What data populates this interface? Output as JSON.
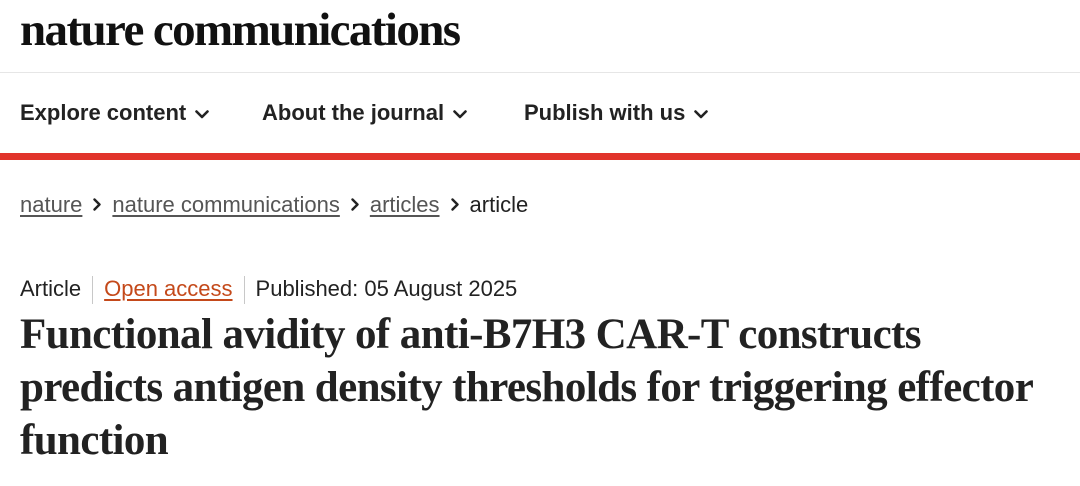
{
  "masthead": {
    "logo_text": "nature communications"
  },
  "nav": {
    "items": [
      {
        "label": "Explore content"
      },
      {
        "label": "About the journal"
      },
      {
        "label": "Publish with us"
      }
    ]
  },
  "breadcrumb": {
    "links": [
      "nature",
      "nature communications",
      "articles"
    ],
    "current": "article"
  },
  "article_meta": {
    "type": "Article",
    "access": "Open access",
    "published": "Published: 05 August 2025"
  },
  "article": {
    "title": "Functional avidity of anti-B7H3 CAR-T constructs predicts antigen density thresholds for triggering effector function"
  },
  "colors": {
    "accent_red": "#e1342b",
    "open_access": "#c4491a",
    "text": "#222222"
  },
  "icons": {
    "nav_dropdown": "chevron-down-icon",
    "breadcrumb_separator": "chevron-right-icon"
  }
}
